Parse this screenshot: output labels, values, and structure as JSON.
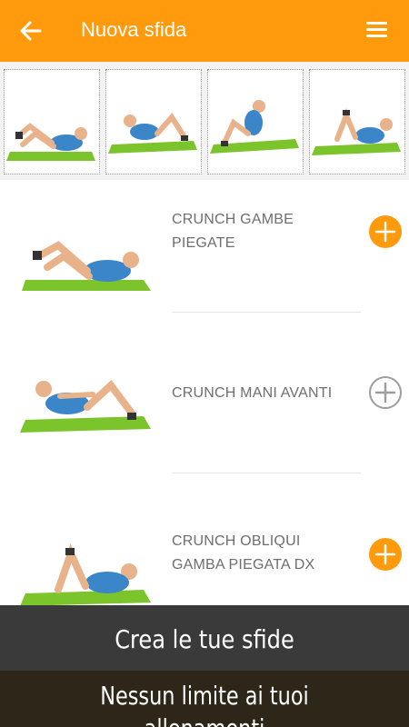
{
  "header": {
    "title": "Nuova sfida",
    "background_color": "#fe9a0c",
    "back_icon": "arrow-left-icon",
    "menu_icon": "hamburger-menu-icon"
  },
  "thumbnail_strip": {
    "count": 4
  },
  "exercises": [
    {
      "name": "CRUNCH GAMBE PIEGATE",
      "added": true
    },
    {
      "name": "CRUNCH MANI AVANTI",
      "added": false
    },
    {
      "name": "CRUNCH OBLIQUI GAMBA PIEGATA DX",
      "added": true
    }
  ],
  "banner": {
    "line1": "Crea le tue sfide",
    "line2": "Nessun limite ai tuoi allenamenti"
  },
  "colors": {
    "accent": "#fe9a0c",
    "mat_green": "#7cc42b",
    "add_inactive": "#9e9e9e"
  }
}
